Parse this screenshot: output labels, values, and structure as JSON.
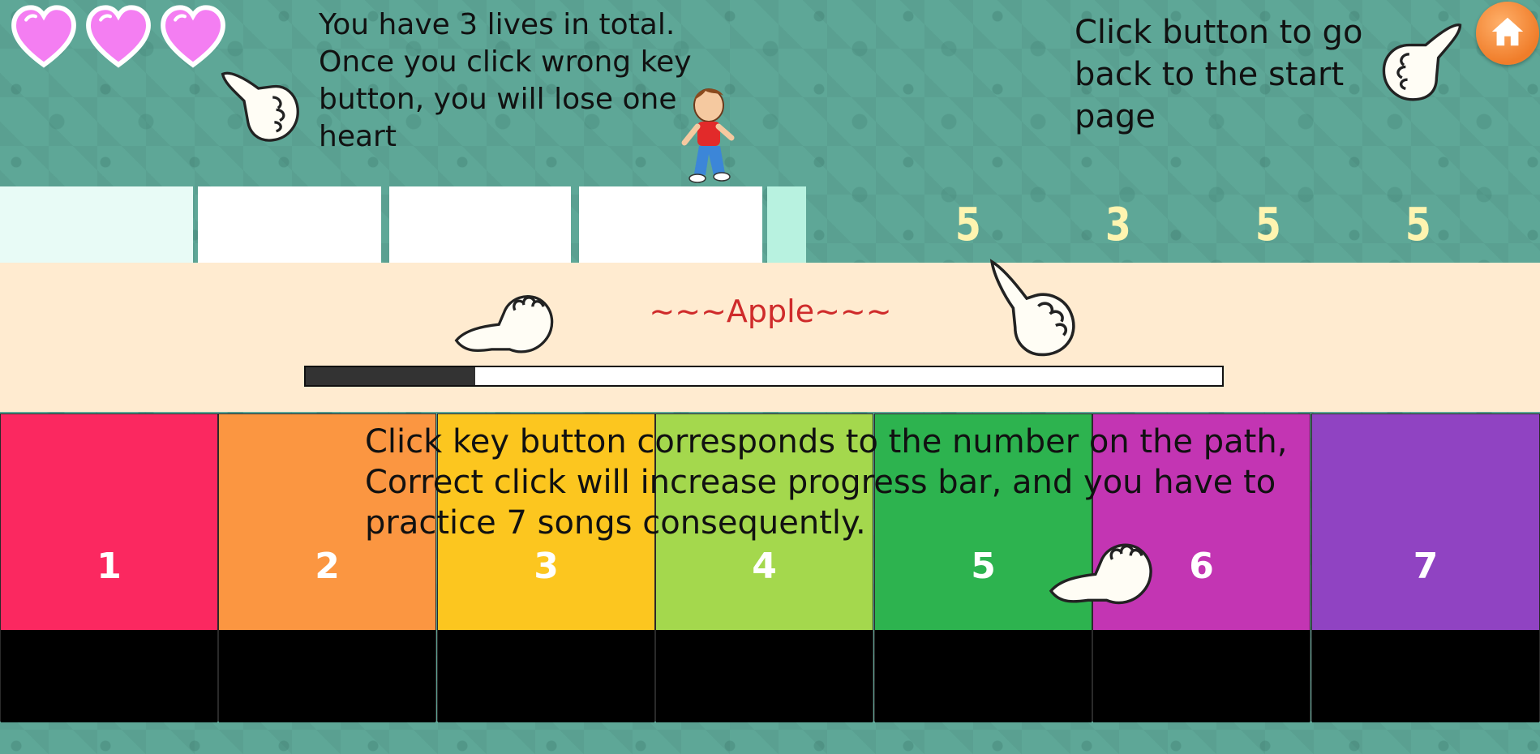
{
  "lives": {
    "total": 3,
    "remaining": 3,
    "heart_color": "#f27ef0"
  },
  "lives_hint": {
    "lines": [
      "You have 3 lives in total.",
      "Once you click wrong key",
      "button, you will lose one",
      "heart"
    ]
  },
  "home_hint": {
    "lines": [
      "Click button to go",
      "back to the start",
      "page"
    ]
  },
  "home_button": {
    "icon": "home-icon",
    "color": "#f28a35"
  },
  "path": {
    "numbers": [
      "5",
      "3",
      "5",
      "5"
    ]
  },
  "song": {
    "title": "~~~Apple~~~",
    "progress_fraction": 0.185
  },
  "instructions": {
    "lines": [
      "Click key button corresponds to the number on the path,",
      "Correct click will increase progress bar, and you have to",
      "practice 7 songs consequently."
    ]
  },
  "keys": [
    {
      "label": "1",
      "color": "#fb2860"
    },
    {
      "label": "2",
      "color": "#fb9641"
    },
    {
      "label": "3",
      "color": "#fcc61f"
    },
    {
      "label": "4",
      "color": "#a4d84d"
    },
    {
      "label": "5",
      "color": "#2db34f"
    },
    {
      "label": "6",
      "color": "#c335b3"
    },
    {
      "label": "7",
      "color": "#9043c2"
    }
  ]
}
